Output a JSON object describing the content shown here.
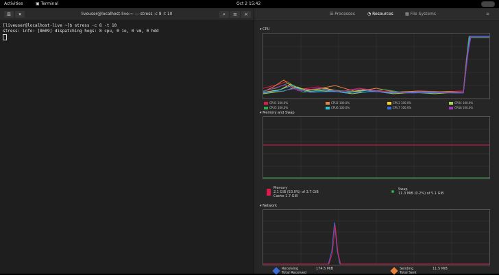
{
  "topbar": {
    "activities": "Activities",
    "app": "Terminal",
    "clock": "Oct 2  15:42"
  },
  "terminal": {
    "title": "liveuser@localhost-live:~ — stress -c 8 -t 10",
    "lines": [
      "[liveuser@localhost-live ~]$ stress -c 8 -t 10",
      "stress: info: [8609] dispatching hogs: 8 cpu, 0 io, 0 vm, 0 hdd"
    ]
  },
  "monitor": {
    "tabs": [
      "Processes",
      "Resources",
      "File Systems"
    ],
    "cpu": {
      "title": "CPU",
      "legend": [
        {
          "label": "CPU1 100.0%",
          "color": "#e01b4c"
        },
        {
          "label": "CPU2 100.0%",
          "color": "#e8813a"
        },
        {
          "label": "CPU3 100.0%",
          "color": "#f5d418"
        },
        {
          "label": "CPU4 100.0%",
          "color": "#a6d64a"
        },
        {
          "label": "CPU5 100.0%",
          "color": "#2ea84a"
        },
        {
          "label": "CPU6 100.0%",
          "color": "#31c2d4"
        },
        {
          "label": "CPU7 100.0%",
          "color": "#3b6cd6"
        },
        {
          "label": "CPU8 100.0%",
          "color": "#9d37b8"
        }
      ]
    },
    "memory": {
      "title": "Memory and Swap",
      "mem_label": "Memory",
      "mem_value": "2.1 GiB (53.0%) of 3.7 GiB",
      "cache_value": "Cache 1.7 GiB",
      "swap_label": "Swap",
      "swap_value": "11.3 MiB (0.2%) of 5.1 GiB"
    },
    "network": {
      "title": "Network",
      "recv_label": "Receiving",
      "recv_total_label": "Total Received",
      "recv_value": "174.5 MiB",
      "send_label": "Sending",
      "send_total_label": "Total Sent",
      "send_value": "11.5 MiB"
    }
  }
}
